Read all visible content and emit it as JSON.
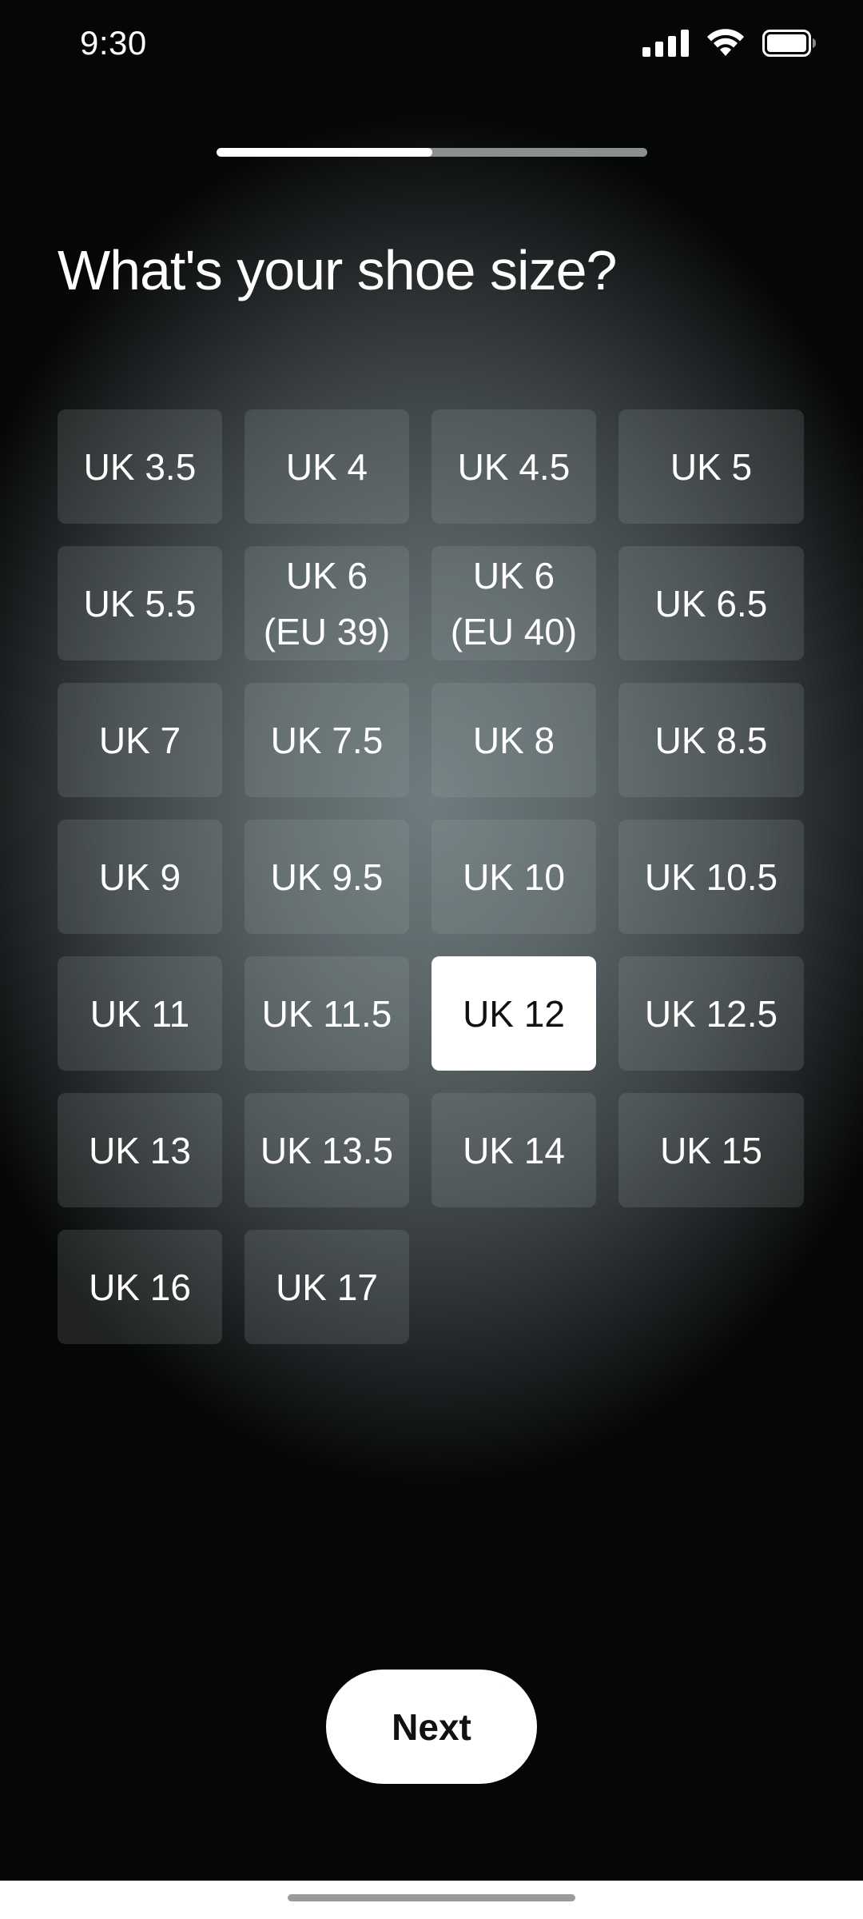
{
  "status_bar": {
    "time": "9:30",
    "icons": [
      "cellular-signal-icon",
      "wifi-icon",
      "battery-icon"
    ]
  },
  "progress": {
    "fraction": 0.5
  },
  "title": "What's your shoe size?",
  "sizes": [
    {
      "label": "UK 3.5",
      "selected": false
    },
    {
      "label": "UK 4",
      "selected": false
    },
    {
      "label": "UK 4.5",
      "selected": false
    },
    {
      "label": "UK 5",
      "selected": false
    },
    {
      "label": "UK 5.5",
      "selected": false
    },
    {
      "label": "UK 6\n(EU 39)",
      "selected": false
    },
    {
      "label": "UK 6\n(EU 40)",
      "selected": false
    },
    {
      "label": "UK 6.5",
      "selected": false
    },
    {
      "label": "UK 7",
      "selected": false
    },
    {
      "label": "UK 7.5",
      "selected": false
    },
    {
      "label": "UK 8",
      "selected": false
    },
    {
      "label": "UK 8.5",
      "selected": false
    },
    {
      "label": "UK 9",
      "selected": false
    },
    {
      "label": "UK 9.5",
      "selected": false
    },
    {
      "label": "UK 10",
      "selected": false
    },
    {
      "label": "UK 10.5",
      "selected": false
    },
    {
      "label": "UK 11",
      "selected": false
    },
    {
      "label": "UK 11.5",
      "selected": false
    },
    {
      "label": "UK 12",
      "selected": true
    },
    {
      "label": "UK 12.5",
      "selected": false
    },
    {
      "label": "UK 13",
      "selected": false
    },
    {
      "label": "UK 13.5",
      "selected": false
    },
    {
      "label": "UK 14",
      "selected": false
    },
    {
      "label": "UK 15",
      "selected": false
    },
    {
      "label": "UK 16",
      "selected": false
    },
    {
      "label": "UK 17",
      "selected": false
    }
  ],
  "next_button": {
    "label": "Next"
  },
  "colors": {
    "selected_background": "#ffffff",
    "option_background": "#4a5457",
    "accent_text": "#ffffff"
  }
}
